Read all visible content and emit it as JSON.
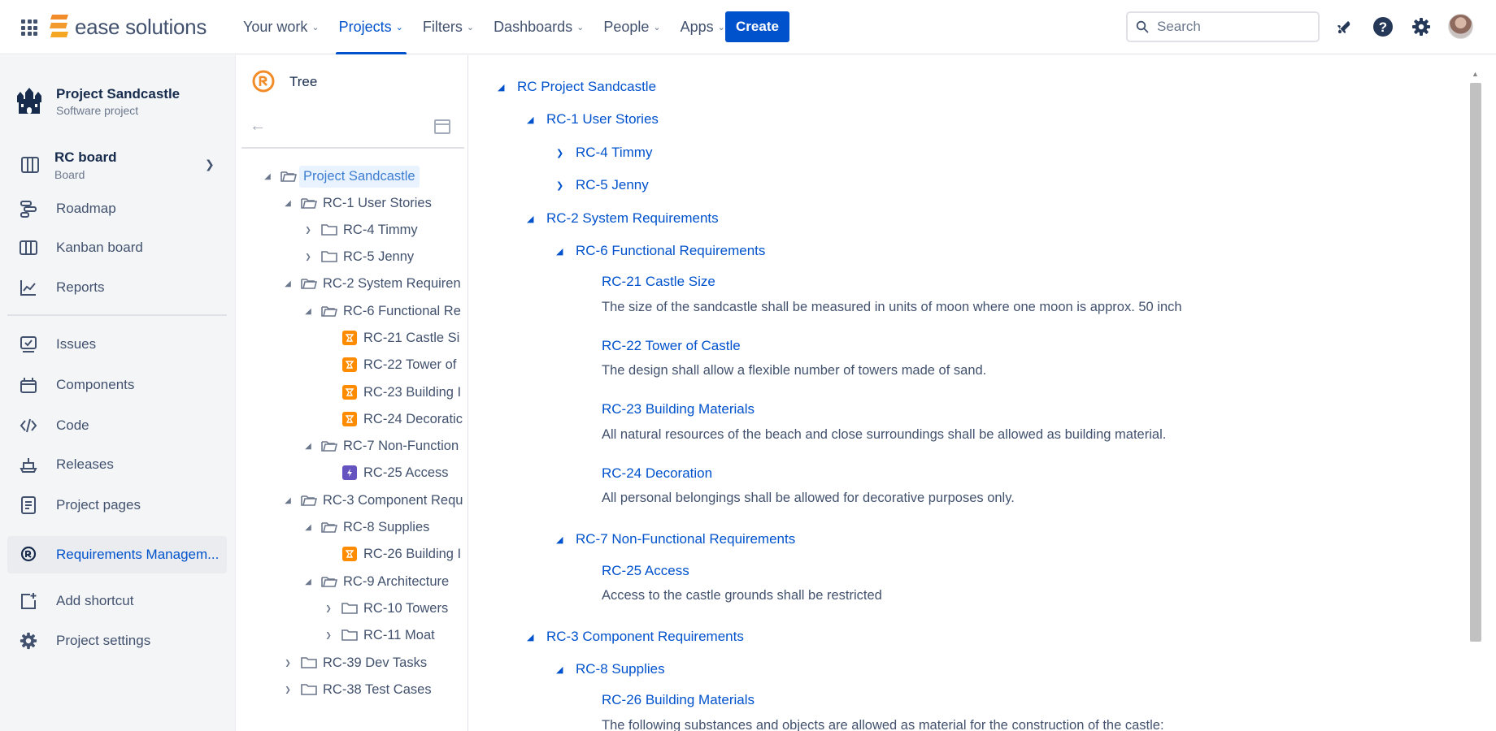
{
  "header": {
    "logo_text": "ease solutions",
    "nav": [
      {
        "label": "Your work",
        "active": false
      },
      {
        "label": "Projects",
        "active": true
      },
      {
        "label": "Filters",
        "active": false
      },
      {
        "label": "Dashboards",
        "active": false
      },
      {
        "label": "People",
        "active": false
      },
      {
        "label": "Apps",
        "active": false
      }
    ],
    "create_label": "Create",
    "search_placeholder": "Search",
    "accent_color": "#0052CC"
  },
  "sidebar": {
    "project_name": "Project Sandcastle",
    "project_type": "Software project",
    "board_name": "RC board",
    "board_type": "Board",
    "items": [
      {
        "label": "Roadmap",
        "icon": "roadmap-icon"
      },
      {
        "label": "Kanban board",
        "icon": "kanban-board-icon"
      },
      {
        "label": "Reports",
        "icon": "reports-icon"
      },
      {
        "label": "Issues",
        "icon": "issues-icon"
      },
      {
        "label": "Components",
        "icon": "components-icon"
      },
      {
        "label": "Code",
        "icon": "code-icon"
      },
      {
        "label": "Releases",
        "icon": "releases-icon"
      },
      {
        "label": "Project pages",
        "icon": "project-pages-icon"
      },
      {
        "label": "Requirements Managem...",
        "icon": "requirements-icon",
        "active": true
      },
      {
        "label": "Add shortcut",
        "icon": "add-shortcut-icon"
      },
      {
        "label": "Project settings",
        "icon": "gear-icon"
      }
    ]
  },
  "tree": {
    "title": "Tree",
    "nodes": [
      {
        "label": "Project Sandcastle",
        "icon": "folder-open",
        "toggle": "expanded",
        "root": true
      },
      {
        "label": "RC-1 User Stories",
        "icon": "folder-open",
        "toggle": "expanded"
      },
      {
        "label": "RC-4 Timmy",
        "icon": "folder",
        "toggle": "collapsed"
      },
      {
        "label": "RC-5 Jenny",
        "icon": "folder",
        "toggle": "collapsed"
      },
      {
        "label": "RC-2 System Requiren",
        "icon": "folder-open",
        "toggle": "expanded"
      },
      {
        "label": "RC-6 Functional Re",
        "icon": "folder-open",
        "toggle": "expanded"
      },
      {
        "label": "RC-21 Castle Si",
        "icon": "requirement",
        "toggle": "none"
      },
      {
        "label": "RC-22 Tower of",
        "icon": "requirement",
        "toggle": "none"
      },
      {
        "label": "RC-23 Building I",
        "icon": "requirement",
        "toggle": "none"
      },
      {
        "label": "RC-24 Decoratic",
        "icon": "requirement",
        "toggle": "none"
      },
      {
        "label": "RC-7 Non-Function",
        "icon": "folder-open",
        "toggle": "expanded"
      },
      {
        "label": "RC-25 Access",
        "icon": "story",
        "toggle": "none"
      },
      {
        "label": "RC-3 Component Requ",
        "icon": "folder-open",
        "toggle": "expanded"
      },
      {
        "label": "RC-8 Supplies",
        "icon": "folder-open",
        "toggle": "expanded"
      },
      {
        "label": "RC-26 Building I",
        "icon": "requirement",
        "toggle": "none"
      },
      {
        "label": "RC-9 Architecture",
        "icon": "folder-open",
        "toggle": "expanded"
      },
      {
        "label": "RC-10 Towers",
        "icon": "folder",
        "toggle": "collapsed"
      },
      {
        "label": "RC-11 Moat",
        "icon": "folder",
        "toggle": "collapsed"
      },
      {
        "label": "RC-39 Dev Tasks",
        "icon": "folder",
        "toggle": "collapsed"
      },
      {
        "label": "RC-38 Test Cases",
        "icon": "folder",
        "toggle": "collapsed"
      }
    ]
  },
  "document": {
    "headings": [
      {
        "label": "RC Project Sandcastle",
        "toggle": "expanded"
      },
      {
        "label": "RC-1 User Stories",
        "toggle": "expanded"
      },
      {
        "label": "RC-4 Timmy",
        "toggle": "collapsed"
      },
      {
        "label": "RC-5 Jenny",
        "toggle": "collapsed"
      },
      {
        "label": "RC-2 System Requirements",
        "toggle": "expanded"
      },
      {
        "label": "RC-6 Functional Requirements",
        "toggle": "expanded"
      },
      {
        "label": "RC-7 Non-Functional Requirements",
        "toggle": "expanded"
      },
      {
        "label": "RC-3 Component Requirements",
        "toggle": "expanded"
      },
      {
        "label": "RC-8 Supplies",
        "toggle": "expanded"
      }
    ],
    "requirements": [
      {
        "title": "RC-21 Castle Size",
        "desc": "The size of the sandcastle shall be measured in units of  moon where one moon is approx. 50 inch"
      },
      {
        "title": "RC-22 Tower of Castle",
        "desc": "The design shall allow a flexible number of towers made of sand."
      },
      {
        "title": "RC-23 Building Materials",
        "desc": "All natural resources of the beach and close surroundings shall be allowed as building material."
      },
      {
        "title": "RC-24 Decoration",
        "desc": "All personal belongings shall be allowed for decorative purposes only."
      },
      {
        "title": "RC-25 Access",
        "desc": "Access to the castle grounds shall be restricted"
      },
      {
        "title": "RC-26 Building Materials",
        "desc": "The following substances and objects are allowed as material for the construction of the castle:"
      }
    ]
  }
}
